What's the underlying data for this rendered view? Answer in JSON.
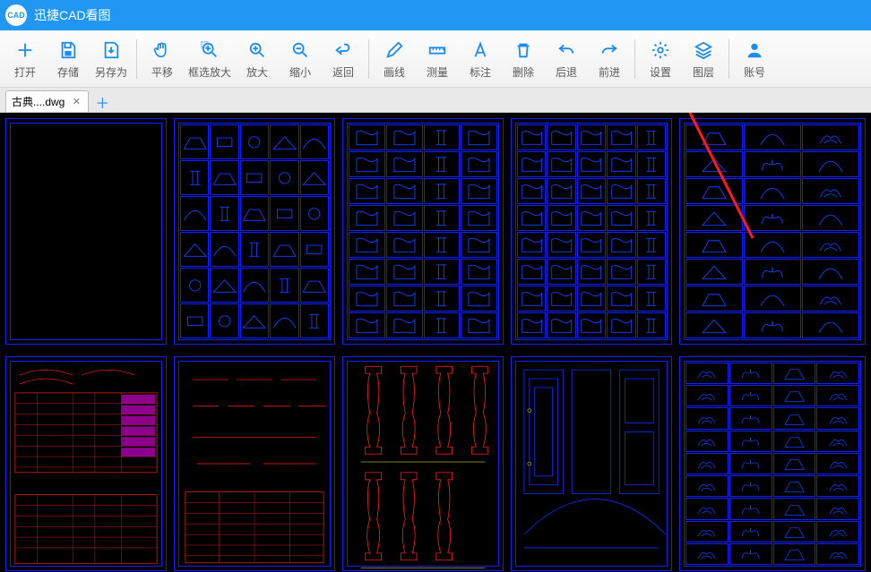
{
  "app": {
    "title": "迅捷CAD看图",
    "logo_text": "CAD"
  },
  "toolbar": {
    "open": "打开",
    "save": "存储",
    "saveas": "另存为",
    "pan": "平移",
    "boxzoom": "框选放大",
    "zoomin": "放大",
    "zoomout": "缩小",
    "back": "返回",
    "line": "画线",
    "measure": "测量",
    "annotate": "标注",
    "delete": "删除",
    "undo": "后退",
    "redo": "前进",
    "settings": "设置",
    "layers": "图层",
    "account": "账号"
  },
  "tab": {
    "name": "古典....dwg"
  }
}
